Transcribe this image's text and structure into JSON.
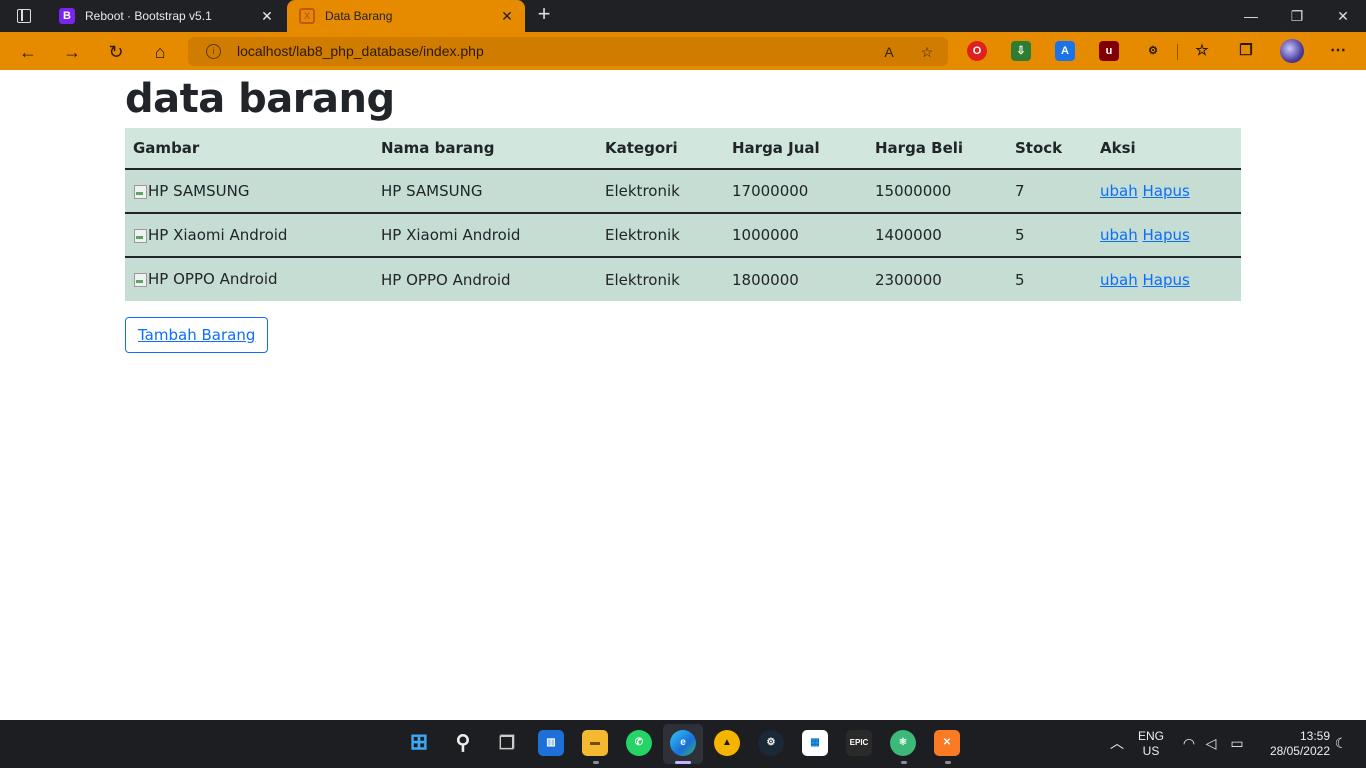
{
  "browser": {
    "tabs": [
      {
        "title": "Reboot · Bootstrap v5.1",
        "favicon": "B"
      },
      {
        "title": "Data Barang",
        "favicon": "X"
      }
    ],
    "url": "localhost/lab8_php_database/index.php",
    "accent": "#e68b00"
  },
  "page": {
    "heading": "data barang",
    "table": {
      "headers": [
        "Gambar",
        "Nama barang",
        "Kategori",
        "Harga Jual",
        "Harga Beli",
        "Stock",
        "Aksi"
      ],
      "rows": [
        {
          "gambar_alt": "HP SAMSUNG",
          "nama": "HP SAMSUNG",
          "kategori": "Elektronik",
          "harga_jual": "17000000",
          "harga_beli": "15000000",
          "stock": "7",
          "ubah": "ubah",
          "hapus": "Hapus"
        },
        {
          "gambar_alt": "HP Xiaomi Android",
          "nama": "HP Xiaomi Android",
          "kategori": "Elektronik",
          "harga_jual": "1000000",
          "harga_beli": "1400000",
          "stock": "5",
          "ubah": "ubah",
          "hapus": "Hapus"
        },
        {
          "gambar_alt": "HP OPPO Android",
          "nama": "HP OPPO Android",
          "kategori": "Elektronik",
          "harga_jual": "1800000",
          "harga_beli": "2300000",
          "stock": "5",
          "ubah": "ubah",
          "hapus": "Hapus"
        }
      ]
    },
    "add_button": "Tambah Barang"
  },
  "taskbar": {
    "language": "ENG",
    "region": "US",
    "time": "13:59",
    "date": "28/05/2022",
    "epic_label": "EPIC"
  }
}
